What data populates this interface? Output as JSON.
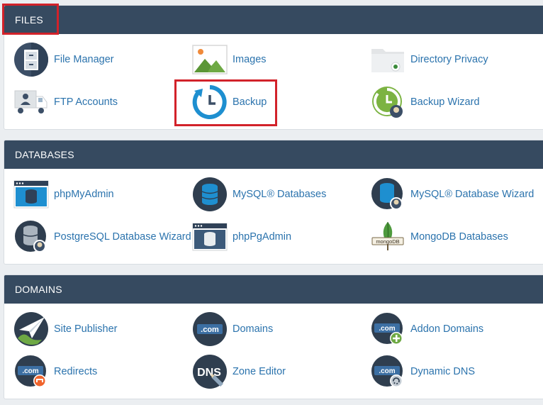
{
  "files": {
    "title": "FILES",
    "items": [
      {
        "label": "File Manager",
        "icon": "file-manager-icon"
      },
      {
        "label": "Images",
        "icon": "images-icon"
      },
      {
        "label": "Directory Privacy",
        "icon": "directory-privacy-icon"
      },
      {
        "label": "FTP Accounts",
        "icon": "ftp-accounts-icon"
      },
      {
        "label": "Backup",
        "icon": "backup-icon"
      },
      {
        "label": "Backup Wizard",
        "icon": "backup-wizard-icon"
      }
    ]
  },
  "databases": {
    "title": "DATABASES",
    "items": [
      {
        "label": "phpMyAdmin",
        "icon": "phpmyadmin-icon"
      },
      {
        "label": "MySQL® Databases",
        "icon": "mysql-databases-icon"
      },
      {
        "label": "MySQL® Database Wizard",
        "icon": "mysql-database-wizard-icon"
      },
      {
        "label": "PostgreSQL Database Wizard",
        "icon": "postgresql-database-wizard-icon"
      },
      {
        "label": "phpPgAdmin",
        "icon": "phppgadmin-icon"
      },
      {
        "label": "MongoDB Databases",
        "icon": "mongodb-databases-icon"
      }
    ]
  },
  "domains": {
    "title": "DOMAINS",
    "items": [
      {
        "label": "Site Publisher",
        "icon": "site-publisher-icon"
      },
      {
        "label": "Domains",
        "icon": "domains-icon"
      },
      {
        "label": "Addon Domains",
        "icon": "addon-domains-icon"
      },
      {
        "label": "Redirects",
        "icon": "redirects-icon"
      },
      {
        "label": "Zone Editor",
        "icon": "zone-editor-icon"
      },
      {
        "label": "Dynamic DNS",
        "icon": "dynamic-dns-icon"
      }
    ]
  },
  "icon_text": {
    "com": ".com",
    "dns": "DNS",
    "mongo": "mongoDB"
  },
  "colors": {
    "header_bg": "#364a60",
    "link": "#2b73ad",
    "highlight": "#d2222a",
    "page_bg": "#ebeef1"
  }
}
